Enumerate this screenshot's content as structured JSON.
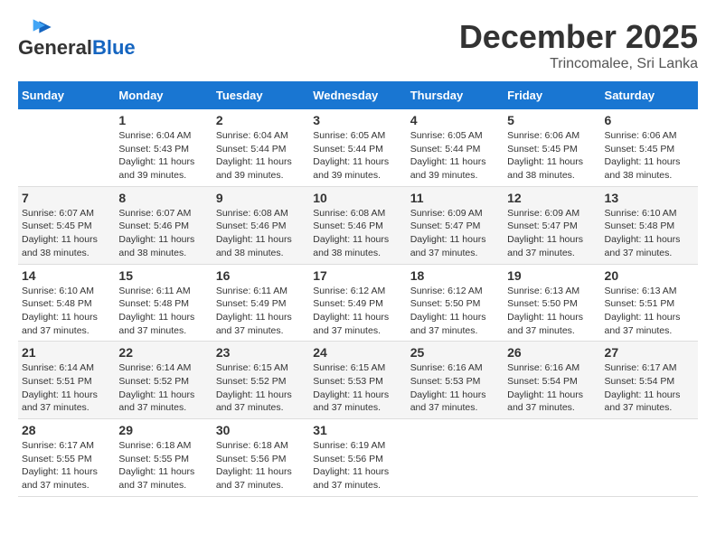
{
  "header": {
    "logo_general": "General",
    "logo_blue": "Blue",
    "month": "December 2025",
    "location": "Trincomalee, Sri Lanka"
  },
  "days_of_week": [
    "Sunday",
    "Monday",
    "Tuesday",
    "Wednesday",
    "Thursday",
    "Friday",
    "Saturday"
  ],
  "weeks": [
    [
      {
        "day": "",
        "info": ""
      },
      {
        "day": "1",
        "info": "Sunrise: 6:04 AM\nSunset: 5:43 PM\nDaylight: 11 hours\nand 39 minutes."
      },
      {
        "day": "2",
        "info": "Sunrise: 6:04 AM\nSunset: 5:44 PM\nDaylight: 11 hours\nand 39 minutes."
      },
      {
        "day": "3",
        "info": "Sunrise: 6:05 AM\nSunset: 5:44 PM\nDaylight: 11 hours\nand 39 minutes."
      },
      {
        "day": "4",
        "info": "Sunrise: 6:05 AM\nSunset: 5:44 PM\nDaylight: 11 hours\nand 39 minutes."
      },
      {
        "day": "5",
        "info": "Sunrise: 6:06 AM\nSunset: 5:45 PM\nDaylight: 11 hours\nand 38 minutes."
      },
      {
        "day": "6",
        "info": "Sunrise: 6:06 AM\nSunset: 5:45 PM\nDaylight: 11 hours\nand 38 minutes."
      }
    ],
    [
      {
        "day": "7",
        "info": "Sunrise: 6:07 AM\nSunset: 5:45 PM\nDaylight: 11 hours\nand 38 minutes."
      },
      {
        "day": "8",
        "info": "Sunrise: 6:07 AM\nSunset: 5:46 PM\nDaylight: 11 hours\nand 38 minutes."
      },
      {
        "day": "9",
        "info": "Sunrise: 6:08 AM\nSunset: 5:46 PM\nDaylight: 11 hours\nand 38 minutes."
      },
      {
        "day": "10",
        "info": "Sunrise: 6:08 AM\nSunset: 5:46 PM\nDaylight: 11 hours\nand 38 minutes."
      },
      {
        "day": "11",
        "info": "Sunrise: 6:09 AM\nSunset: 5:47 PM\nDaylight: 11 hours\nand 37 minutes."
      },
      {
        "day": "12",
        "info": "Sunrise: 6:09 AM\nSunset: 5:47 PM\nDaylight: 11 hours\nand 37 minutes."
      },
      {
        "day": "13",
        "info": "Sunrise: 6:10 AM\nSunset: 5:48 PM\nDaylight: 11 hours\nand 37 minutes."
      }
    ],
    [
      {
        "day": "14",
        "info": "Sunrise: 6:10 AM\nSunset: 5:48 PM\nDaylight: 11 hours\nand 37 minutes."
      },
      {
        "day": "15",
        "info": "Sunrise: 6:11 AM\nSunset: 5:48 PM\nDaylight: 11 hours\nand 37 minutes."
      },
      {
        "day": "16",
        "info": "Sunrise: 6:11 AM\nSunset: 5:49 PM\nDaylight: 11 hours\nand 37 minutes."
      },
      {
        "day": "17",
        "info": "Sunrise: 6:12 AM\nSunset: 5:49 PM\nDaylight: 11 hours\nand 37 minutes."
      },
      {
        "day": "18",
        "info": "Sunrise: 6:12 AM\nSunset: 5:50 PM\nDaylight: 11 hours\nand 37 minutes."
      },
      {
        "day": "19",
        "info": "Sunrise: 6:13 AM\nSunset: 5:50 PM\nDaylight: 11 hours\nand 37 minutes."
      },
      {
        "day": "20",
        "info": "Sunrise: 6:13 AM\nSunset: 5:51 PM\nDaylight: 11 hours\nand 37 minutes."
      }
    ],
    [
      {
        "day": "21",
        "info": "Sunrise: 6:14 AM\nSunset: 5:51 PM\nDaylight: 11 hours\nand 37 minutes."
      },
      {
        "day": "22",
        "info": "Sunrise: 6:14 AM\nSunset: 5:52 PM\nDaylight: 11 hours\nand 37 minutes."
      },
      {
        "day": "23",
        "info": "Sunrise: 6:15 AM\nSunset: 5:52 PM\nDaylight: 11 hours\nand 37 minutes."
      },
      {
        "day": "24",
        "info": "Sunrise: 6:15 AM\nSunset: 5:53 PM\nDaylight: 11 hours\nand 37 minutes."
      },
      {
        "day": "25",
        "info": "Sunrise: 6:16 AM\nSunset: 5:53 PM\nDaylight: 11 hours\nand 37 minutes."
      },
      {
        "day": "26",
        "info": "Sunrise: 6:16 AM\nSunset: 5:54 PM\nDaylight: 11 hours\nand 37 minutes."
      },
      {
        "day": "27",
        "info": "Sunrise: 6:17 AM\nSunset: 5:54 PM\nDaylight: 11 hours\nand 37 minutes."
      }
    ],
    [
      {
        "day": "28",
        "info": "Sunrise: 6:17 AM\nSunset: 5:55 PM\nDaylight: 11 hours\nand 37 minutes."
      },
      {
        "day": "29",
        "info": "Sunrise: 6:18 AM\nSunset: 5:55 PM\nDaylight: 11 hours\nand 37 minutes."
      },
      {
        "day": "30",
        "info": "Sunrise: 6:18 AM\nSunset: 5:56 PM\nDaylight: 11 hours\nand 37 minutes."
      },
      {
        "day": "31",
        "info": "Sunrise: 6:19 AM\nSunset: 5:56 PM\nDaylight: 11 hours\nand 37 minutes."
      },
      {
        "day": "",
        "info": ""
      },
      {
        "day": "",
        "info": ""
      },
      {
        "day": "",
        "info": ""
      }
    ]
  ]
}
